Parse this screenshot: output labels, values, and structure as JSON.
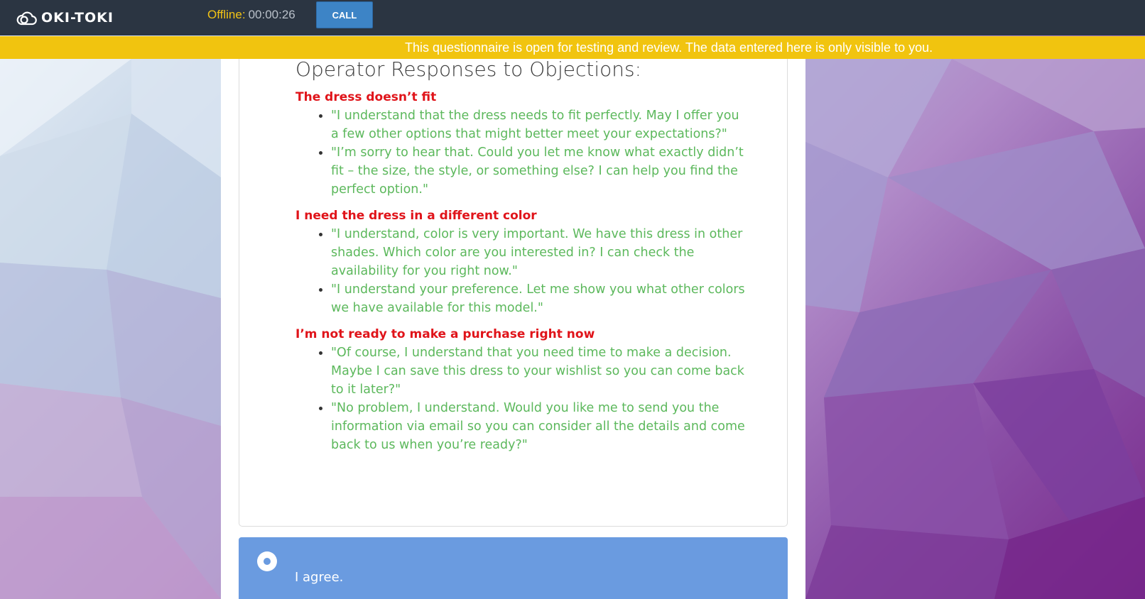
{
  "header": {
    "logo_text": "OKI-TOKI",
    "status_label": "Offline:",
    "timer": "00:00:26",
    "call_label": "CALL"
  },
  "notice": {
    "text": "This questionnaire is open for testing and review. The data entered here is only visible to you."
  },
  "script": {
    "heading": "Operator Responses to Objections:",
    "objections": [
      {
        "title": "The dress doesn’t fit",
        "responses": [
          "\"I understand that the dress needs to fit perfectly. May I offer you a few other options that might better meet your expectations?\"",
          "\"I’m sorry to hear that. Could you let me know what exactly didn’t fit – the size, the style, or something else? I can help you find the perfect option.\""
        ]
      },
      {
        "title": "I need the dress in a different color",
        "responses": [
          "\"I understand, color is very important. We have this dress in other shades. Which color are you interested in? I can check the availability for you right now.\"",
          "\"I understand your preference. Let me show you what other colors we have available for this model.\""
        ]
      },
      {
        "title": "I’m not ready to make a purchase right now",
        "responses": [
          "\"Of course, I understand that you need time to make a decision. Maybe I can save this dress to your wishlist so you can come back to it later?\"",
          "\"No problem, I understand. Would you like me to send you the information via email so you can consider all the details and come back to us when you’re ready?\""
        ]
      }
    ]
  },
  "answer": {
    "label": "I agree."
  },
  "colors": {
    "topbar": "#2b3542",
    "notice": "#f1c40f",
    "status": "#f2c316",
    "call_button": "#3d84c6",
    "objection": "#e0141a",
    "response": "#5cb85c",
    "answer": "#6a9be0"
  },
  "icons": {
    "logo": "cloud-icon",
    "radio": "radio-icon"
  }
}
